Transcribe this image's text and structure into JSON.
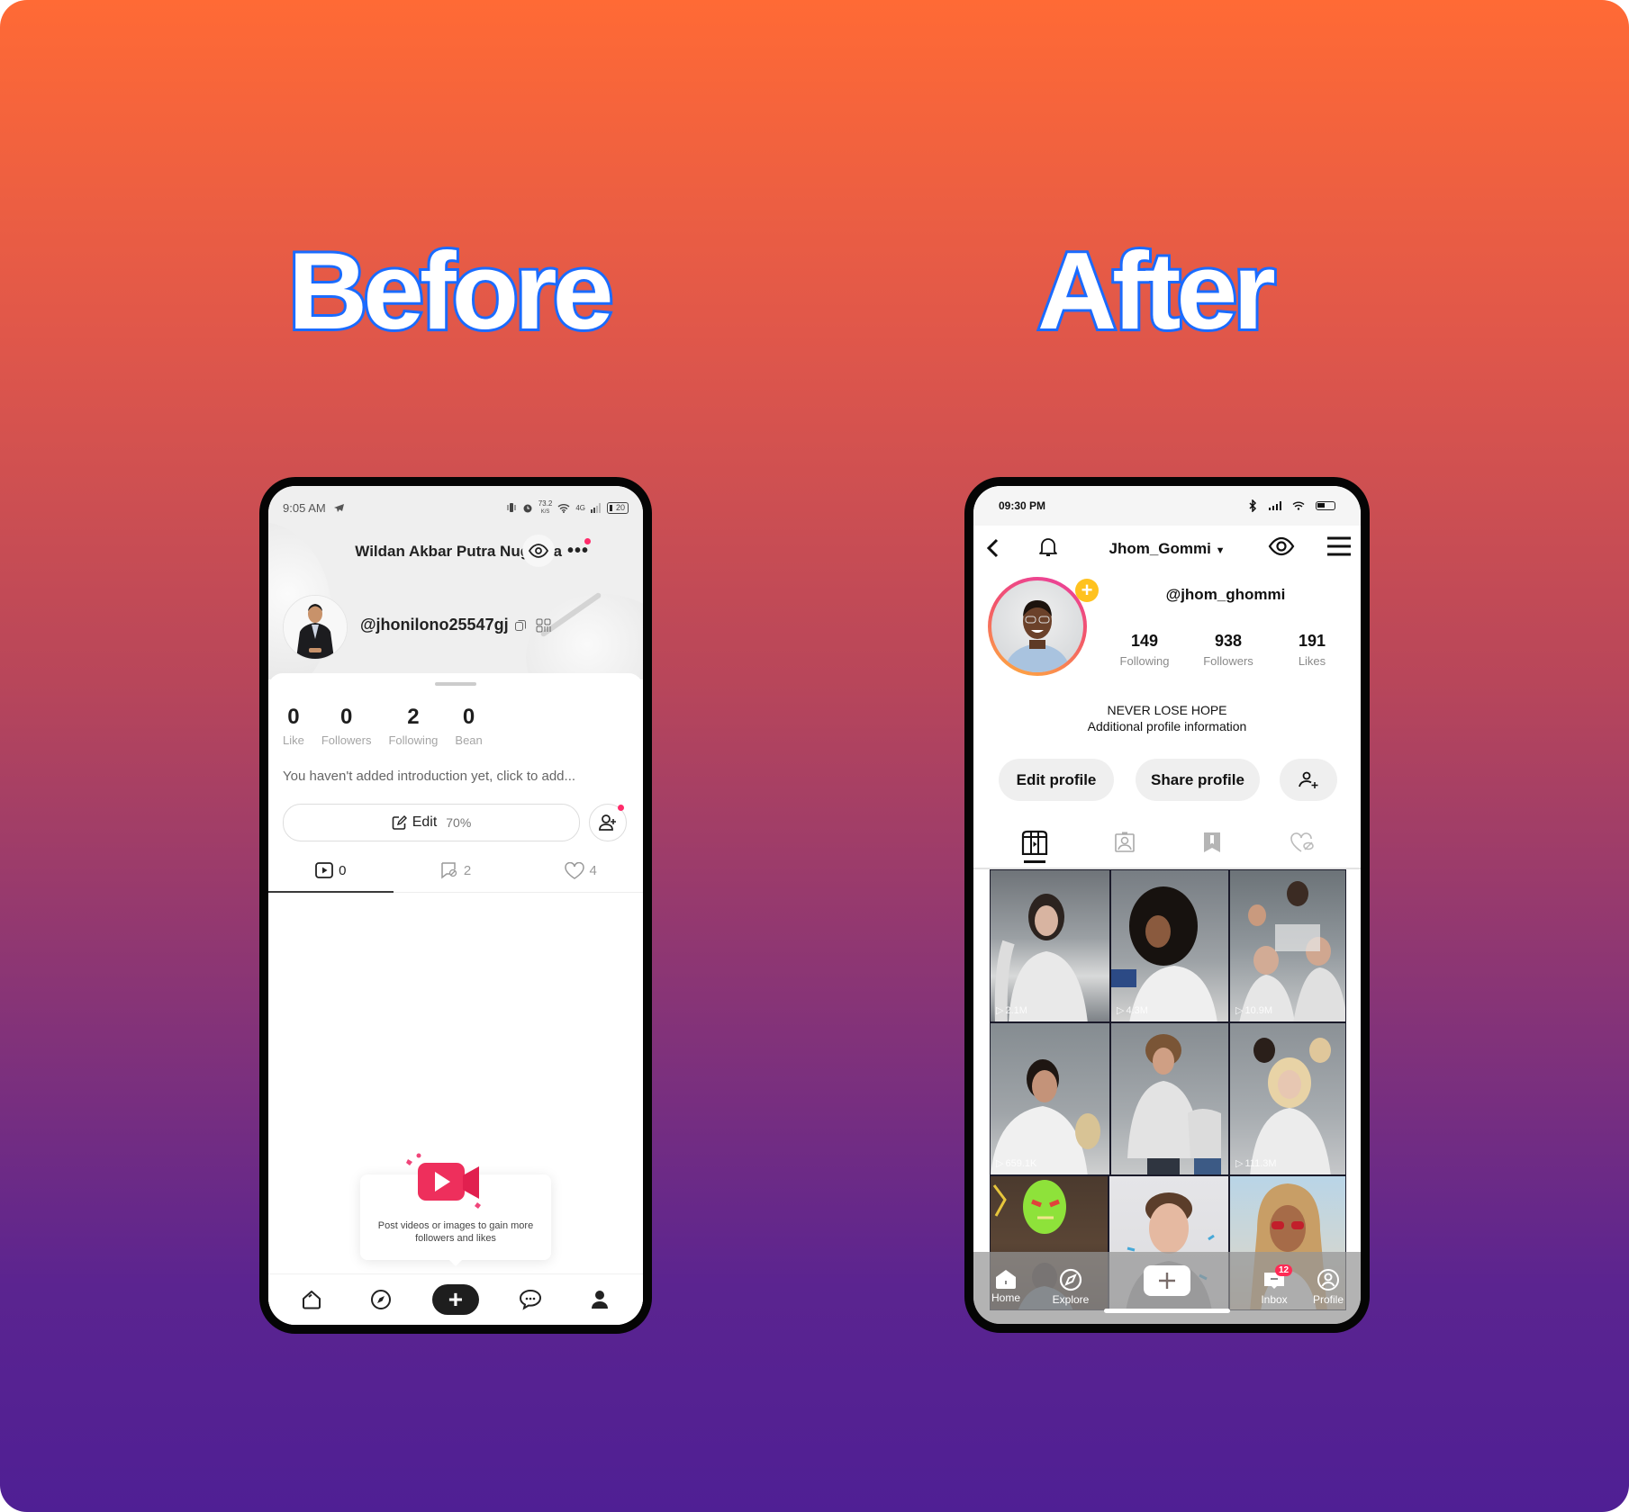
{
  "titles": {
    "before": "Before",
    "after": "After"
  },
  "colors": {
    "bg_top": "#ff6a35",
    "bg_bottom": "#4f1f94",
    "title_stroke": "#1a6bff",
    "accent_red": "#ff2b6a",
    "ring_pink": "#ea3ea0",
    "ring_orange": "#ffb13c",
    "add_badge": "#ffc21f"
  },
  "before": {
    "status": {
      "time": "9:05 AM",
      "net_speed": "73.2",
      "net_unit": "K/S",
      "network": "4G",
      "battery": "20"
    },
    "header": {
      "name": "Wildan Akbar Putra Nugraha",
      "eye_icon": "eye-icon",
      "more_icon": "more-icon"
    },
    "handle": "@jhonilono25547gj",
    "stats": [
      {
        "value": "0",
        "label": "Like"
      },
      {
        "value": "0",
        "label": "Followers"
      },
      {
        "value": "2",
        "label": "Following"
      },
      {
        "value": "0",
        "label": "Bean"
      }
    ],
    "intro": "You haven't added introduction yet, click to add...",
    "edit": {
      "label": "Edit",
      "completion": "70%"
    },
    "tabs": [
      {
        "icon": "video-icon",
        "count": "0"
      },
      {
        "icon": "repost-icon",
        "count": "2"
      },
      {
        "icon": "heart-icon",
        "count": "4"
      }
    ],
    "empty_message": "Post videos or images to gain more followers and likes",
    "nav": [
      "home",
      "explore",
      "create",
      "messages",
      "profile"
    ]
  },
  "after": {
    "status": {
      "time": "09:30 PM"
    },
    "header": {
      "username": "Jhom_Gommi"
    },
    "handle": "@jhom_ghommi",
    "stats": [
      {
        "value": "149",
        "label": "Following"
      },
      {
        "value": "938",
        "label": "Followers"
      },
      {
        "value": "191",
        "label": "Likes"
      }
    ],
    "bio": {
      "line1": "NEVER LOSE HOPE",
      "line2": "Additional profile information"
    },
    "buttons": {
      "edit": "Edit profile",
      "share": "Share profile"
    },
    "tabs": [
      "videos",
      "tagged",
      "saved",
      "liked"
    ],
    "grid": [
      {
        "views": "2.1M"
      },
      {
        "views": "4.3M"
      },
      {
        "views": "10.9M"
      },
      {
        "views": "659.1K"
      },
      {
        "views": ""
      },
      {
        "views": "111.3M"
      },
      {
        "views": ""
      },
      {
        "views": ""
      },
      {
        "views": ""
      }
    ],
    "nav": [
      {
        "label": "Home"
      },
      {
        "label": "Explore"
      },
      {
        "label": "Inbox",
        "badge": "12"
      },
      {
        "label": "Profile"
      }
    ]
  }
}
